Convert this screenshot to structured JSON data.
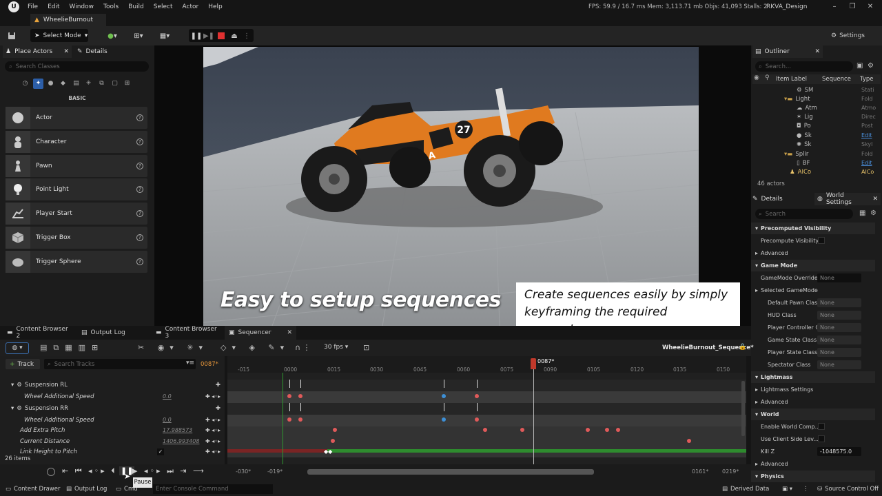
{
  "menubar": {
    "items": [
      "File",
      "Edit",
      "Window",
      "Tools",
      "Build",
      "Select",
      "Actor",
      "Help"
    ],
    "stats": "FPS: 59.9  /  16.7 ms  Mem: 3,113.71 mb  Objs: 41,093  Stalls: 2",
    "project": "RKVA_Design"
  },
  "doc_tab": "WheelieBurnout",
  "toolbar": {
    "select_mode": "Select Mode",
    "settings": "Settings"
  },
  "left_panel": {
    "tab_place": "Place Actors",
    "tab_details": "Details",
    "search_placeholder": "Search Classes",
    "section": "BASIC",
    "actors": [
      "Actor",
      "Character",
      "Pawn",
      "Point Light",
      "Player Start",
      "Trigger Box",
      "Trigger Sphere"
    ]
  },
  "viewport": {
    "caption": "Easy to setup sequences",
    "callout": "Create sequences easily by simply keyframing the required parameters",
    "car_number": "27",
    "car_name": "R.K.V.A"
  },
  "outliner": {
    "title": "Outliner",
    "search_placeholder": "Search...",
    "col_label": "Item Label",
    "col_sequence": "Sequence",
    "col_type": "Type",
    "rows": [
      {
        "label": "SM",
        "type": "Stati"
      },
      {
        "label": "Light",
        "type": "Fold"
      },
      {
        "label": "Atm",
        "type": "Atmo"
      },
      {
        "label": "Lig",
        "type": "Direc"
      },
      {
        "label": "Po",
        "type": "Post"
      },
      {
        "label": "Sk",
        "type": "Edit"
      },
      {
        "label": "Sk",
        "type": "Skyl"
      },
      {
        "label": "Splir",
        "type": "Fold"
      },
      {
        "label": "BF",
        "type": "Edit"
      },
      {
        "label": "AICo",
        "type": "AICo"
      }
    ],
    "count": "46 actors"
  },
  "details": {
    "tab_details": "Details",
    "tab_world": "World Settings",
    "search_placeholder": "Search",
    "rows": [
      {
        "label": "Precomputed Visibility",
        "kind": "section"
      },
      {
        "label": "Precompute Visibility",
        "kind": "check"
      },
      {
        "label": "Advanced",
        "kind": "sub"
      },
      {
        "label": "Game Mode",
        "kind": "section"
      },
      {
        "label": "GameMode Override",
        "kind": "value",
        "value": "None"
      },
      {
        "label": "Selected GameMode",
        "kind": "sub"
      },
      {
        "label": "Default Pawn Class",
        "kind": "value",
        "value": "None"
      },
      {
        "label": "HUD Class",
        "kind": "value",
        "value": "None"
      },
      {
        "label": "Player Controller C",
        "kind": "value",
        "value": "None"
      },
      {
        "label": "Game State Class",
        "kind": "value",
        "value": "None"
      },
      {
        "label": "Player State Class",
        "kind": "value",
        "value": "None"
      },
      {
        "label": "Spectator Class",
        "kind": "value",
        "value": "None"
      },
      {
        "label": "Lightmass",
        "kind": "section"
      },
      {
        "label": "Lightmass Settings",
        "kind": "sub"
      },
      {
        "label": "Advanced",
        "kind": "sub"
      },
      {
        "label": "World",
        "kind": "section"
      },
      {
        "label": "Enable World Comp...",
        "kind": "check"
      },
      {
        "label": "Use Client Side Lev...",
        "kind": "check"
      },
      {
        "label": "Kill Z",
        "kind": "value",
        "value": "-1048575.0"
      },
      {
        "label": "Advanced",
        "kind": "sub"
      },
      {
        "label": "Physics",
        "kind": "section"
      }
    ]
  },
  "bottom_tabs": [
    "Content Browser 2",
    "Output Log",
    "Content Browser 3",
    "Sequencer"
  ],
  "sequencer": {
    "track_button": "Track",
    "search_placeholder": "Search Tracks",
    "current_frame": "0087*",
    "fps": "30 fps",
    "sequence_name": "WheelieBurnout_Sequence*",
    "playhead": "0087*",
    "ticks": [
      "-015",
      "0000",
      "0015",
      "0030",
      "0045",
      "0060",
      "0075",
      "0090",
      "0105",
      "0120",
      "0135",
      "0150"
    ],
    "tracks": [
      {
        "label": "Suspension RL",
        "kind": "group"
      },
      {
        "label": "Wheel Additional Speed",
        "kind": "prop",
        "value": "0.0"
      },
      {
        "label": "Suspension RR",
        "kind": "group"
      },
      {
        "label": "Wheel Additional Speed",
        "kind": "prop",
        "value": "0.0"
      },
      {
        "label": "Add Extra Pitch",
        "kind": "prop",
        "value": "17.988573"
      },
      {
        "label": "Current Distance",
        "kind": "prop",
        "value": "1406.993408"
      },
      {
        "label": "Link Height to Pitch",
        "kind": "bool"
      }
    ],
    "items_count": "26 items",
    "range_start": "-030*",
    "range_in": "-019*",
    "range_out": "0161*",
    "range_end": "0219*",
    "tooltip": "Pause"
  },
  "statusbar": {
    "content_drawer": "Content Drawer",
    "output_log": "Output Log",
    "cmd": "Cmd",
    "console_placeholder": "Enter Console Command",
    "derived_data": "Derived Data",
    "source_control": "Source Control Off"
  }
}
